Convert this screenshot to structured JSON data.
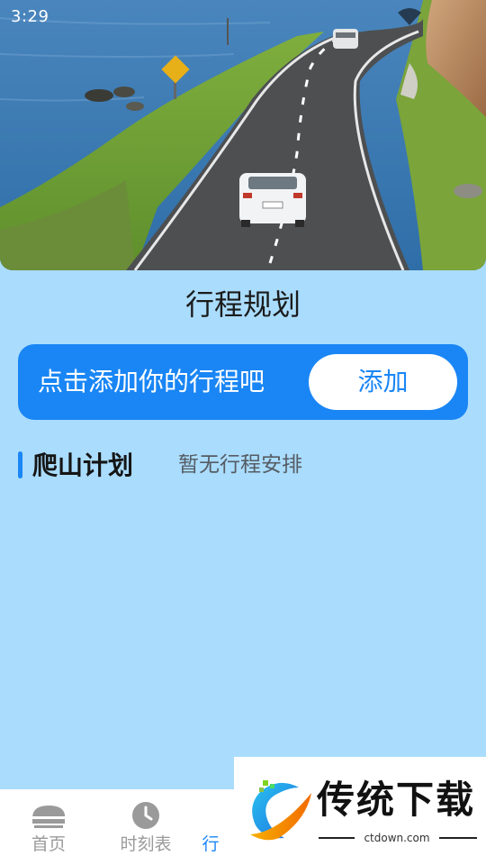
{
  "status_bar": {
    "time": "3:29"
  },
  "hero": {
    "icon": "road-landscape-image"
  },
  "page": {
    "title": "行程规划"
  },
  "add_card": {
    "prompt": "点击添加你的行程吧",
    "button_label": "添加"
  },
  "plan": {
    "label": "爬山计划",
    "empty_text": "暂无行程安排"
  },
  "bottom_nav": {
    "items": [
      {
        "label": "首页",
        "icon": "train-icon"
      },
      {
        "label": "时刻表",
        "icon": "clock-icon"
      },
      {
        "label": "行",
        "icon": "plan-icon",
        "active": true
      }
    ]
  },
  "watermark": {
    "title": "传统下载",
    "url": "ctdown.com"
  },
  "colors": {
    "background": "#aadcfd",
    "accent": "#1a86f5",
    "nav_inactive": "#9a9a9a"
  }
}
